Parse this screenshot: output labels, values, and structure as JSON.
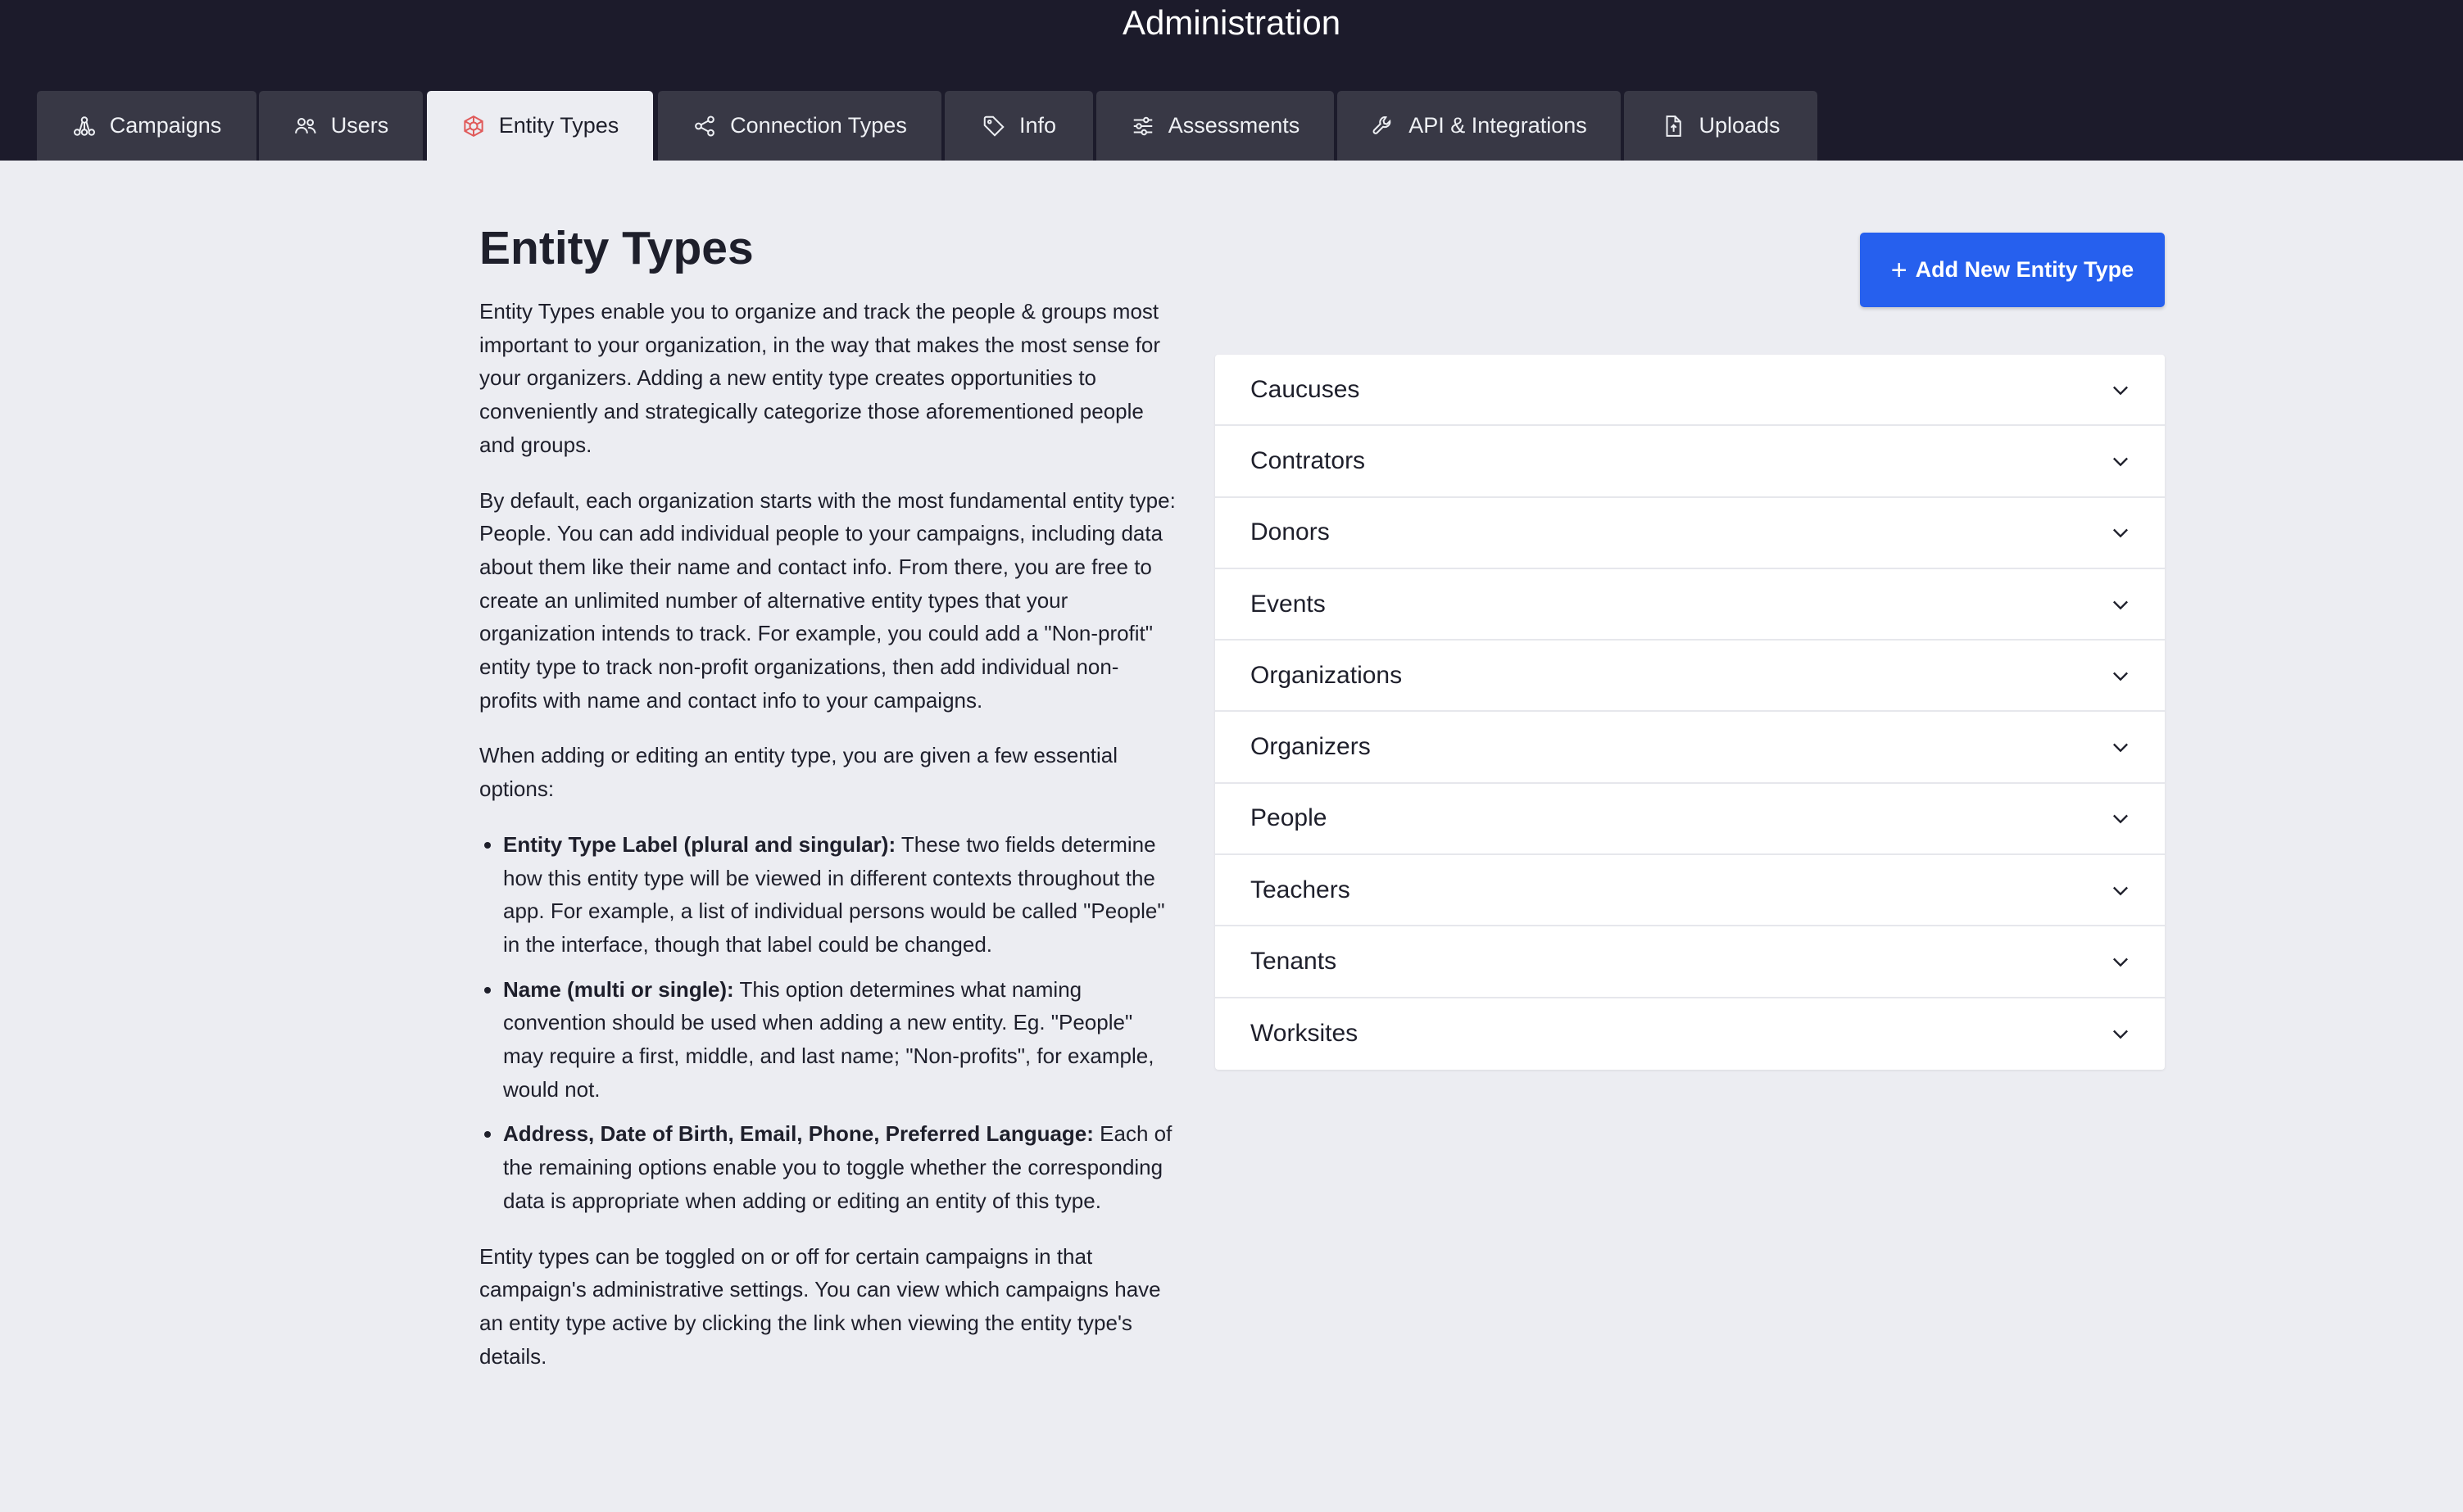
{
  "header": {
    "title": "Administration"
  },
  "tabs": [
    {
      "label": "Campaigns",
      "icon": "hierarchy-icon"
    },
    {
      "label": "Users",
      "icon": "users-icon"
    },
    {
      "label": "Entity Types",
      "icon": "entity-types-icon",
      "active": true
    },
    {
      "label": "Connection Types",
      "icon": "share-nodes-icon"
    },
    {
      "label": "Info",
      "icon": "tag-icon"
    },
    {
      "label": "Assessments",
      "icon": "sliders-icon"
    },
    {
      "label": "API & Integrations",
      "icon": "wrench-icon"
    },
    {
      "label": "Uploads",
      "icon": "file-upload-icon"
    }
  ],
  "colors": {
    "accent": "#2660ee",
    "header_bg": "#1c1b2b",
    "tab_bg": "#383845",
    "active_icon": "#e05a5a"
  },
  "main": {
    "title": "Entity Types",
    "paragraphs": [
      "Entity Types enable you to organize and track the people & groups most important to your organization, in the way that makes the most sense for your organizers. Adding a new entity type creates opportunities to conveniently and strategically categorize those aforementioned people and groups.",
      "By default, each organization starts with the most fundamental entity type: People. You can add individual people to your campaigns, including data about them like their name and contact info. From there, you are free to create an unlimited number of alternative entity types that your organization intends to track. For example, you could add a \"Non-profit\" entity type to track non-profit organizations, then add individual non-profits with name and contact info to your campaigns.",
      "When adding or editing an entity type, you are given a few essential options:"
    ],
    "bullets": [
      {
        "term": "Entity Type Label (plural and singular):",
        "text": " These two fields determine how this entity type will be viewed in different contexts throughout the app. For example, a list of individual persons would be called \"People\" in the interface, though that label could be changed."
      },
      {
        "term": "Name (multi or single):",
        "text": " This option determines what naming convention should be used when adding a new entity. Eg. \"People\" may require a first, middle, and last name; \"Non-profits\", for example, would not."
      },
      {
        "term": "Address, Date of Birth, Email, Phone, Preferred Language:",
        "text": " Each of the remaining options enable you to toggle whether the corresponding data is appropriate when adding or editing an entity of this type."
      }
    ],
    "closing": "Entity types can be toggled on or off for certain campaigns in that campaign's administrative settings. You can view which campaigns have an entity type active by clicking the link when viewing the entity type's details.",
    "add_button_plus": "+",
    "add_button_label": "Add New Entity Type"
  },
  "entity_types": [
    "Caucuses",
    "Contrators",
    "Donors",
    "Events",
    "Organizations",
    "Organizers",
    "People",
    "Teachers",
    "Tenants",
    "Worksites"
  ]
}
